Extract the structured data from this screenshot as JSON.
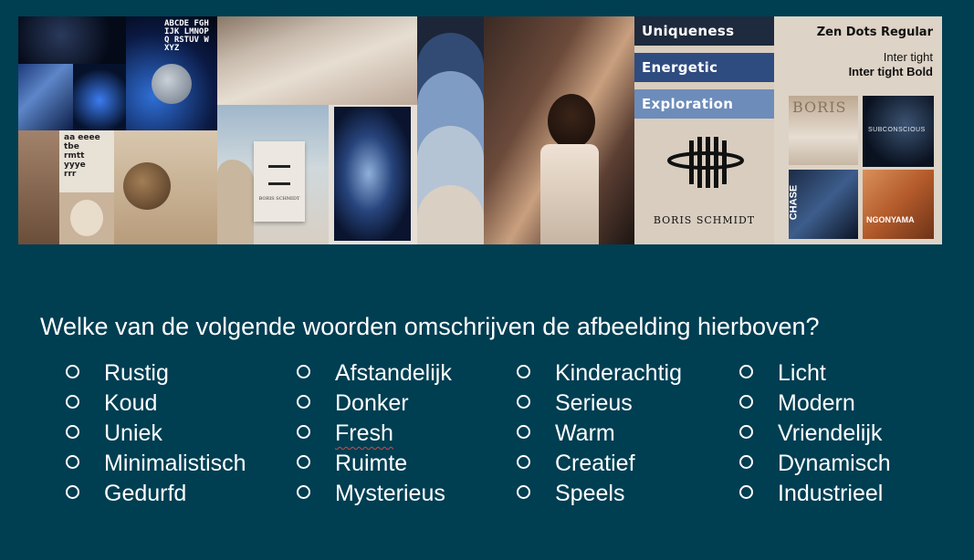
{
  "moodboard": {
    "font_sample": "ABCDE FGHIJK LMNOPQ RSTUV WXYZ",
    "type_sample_rows": [
      "aa eeee",
      "tbe",
      "rmtt",
      "yyye",
      "rrr"
    ],
    "logo_text": "BORIS SCHMIDT",
    "card_logo_text": "BORIS SCHMIDT",
    "words": [
      "Uniqueness",
      "Energetic",
      "Exploration"
    ],
    "font_title": "Zen Dots Regular",
    "font_inter": "Inter tight",
    "font_inter_bold": "Inter tight Bold",
    "thumb_labels": [
      "BORIS",
      "SUBCONSCIOUS",
      "CHASE",
      "NGONYAMA"
    ],
    "colors": {
      "bg": "#003e52",
      "swatch_1": "#1c2638",
      "swatch_2": "#324b74",
      "swatch_3": "#7f9cc4",
      "swatch_4": "#b5c4d4",
      "swatch_5": "#d9cfc2",
      "word_1": "#1e2a3d",
      "word_2": "#2f4c80",
      "word_3": "#6d8cba"
    }
  },
  "question": "Welke van de volgende woorden omschrijven de afbeelding hierboven?",
  "options": [
    [
      "Rustig",
      "Koud",
      "Uniek",
      "Minimalistisch",
      "Gedurfd"
    ],
    [
      "Afstandelijk",
      "Donker",
      "Fresh",
      "Ruimte",
      "Mysterieus"
    ],
    [
      "Kinderachtig",
      "Serieus",
      "Warm",
      "Creatief",
      "Speels"
    ],
    [
      "Licht",
      "Modern",
      "Vriendelijk",
      "Dynamisch",
      "Industrieel"
    ]
  ]
}
